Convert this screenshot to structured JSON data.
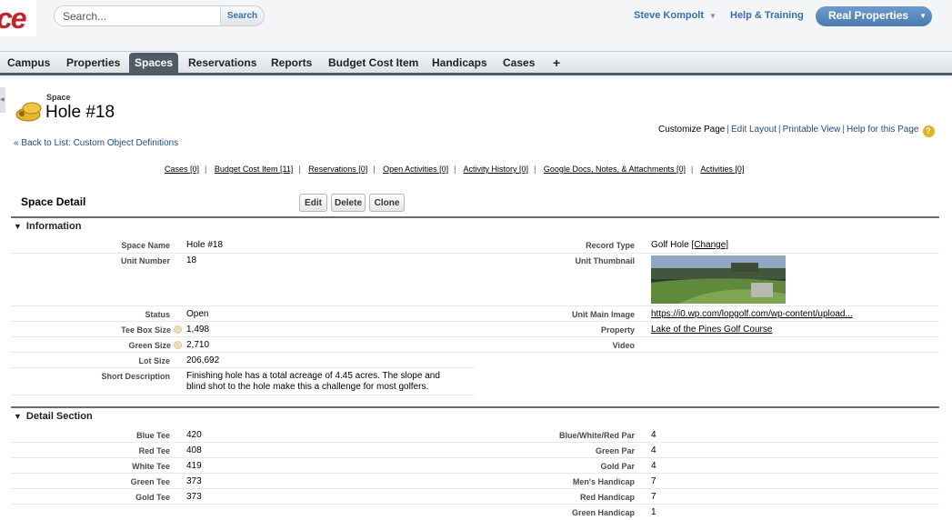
{
  "header": {
    "logo_text": "ce",
    "search_placeholder": "Search...",
    "search_button": "Search",
    "user_name": "Steve Kompolt",
    "help_label": "Help & Training",
    "app_name": "Real Properties"
  },
  "tabs": [
    "Campus",
    "Properties",
    "Spaces",
    "Reservations",
    "Reports",
    "Budget Cost Item",
    "Handicaps",
    "Cases",
    "+"
  ],
  "active_tab": "Spaces",
  "record": {
    "object_type": "Space",
    "title": "Hole #18",
    "back_link": "« Back to List: Custom Object Definitions"
  },
  "page_links": [
    "Customize Page",
    "Edit Layout",
    "Printable View",
    "Help for this Page"
  ],
  "related_links": [
    {
      "label": "Cases",
      "count": "[0]"
    },
    {
      "label": "Budget Cost Item",
      "count": "[11]"
    },
    {
      "label": "Reservations",
      "count": "[0]"
    },
    {
      "label": "Open Activities",
      "count": "[0]"
    },
    {
      "label": "Activity History",
      "count": "[0]"
    },
    {
      "label": "Google Docs, Notes, & Attachments",
      "count": "[0]"
    },
    {
      "label": "Activities",
      "count": "[0]"
    }
  ],
  "detail": {
    "title": "Space Detail",
    "edit_button": "Edit",
    "delete_button": "Delete",
    "clone_button": "Clone"
  },
  "information": {
    "heading": "Information",
    "space_name_label": "Space Name",
    "space_name": "Hole #18",
    "unit_number_label": "Unit Number",
    "unit_number": "18",
    "status_label": "Status",
    "status": "Open",
    "tee_box_label": "Tee Box Size",
    "tee_box": "1,498",
    "green_size_label": "Green Size",
    "green_size": "2,710",
    "lot_size_label": "Lot Size",
    "lot_size": "206,692",
    "short_desc_label": "Short Description",
    "short_desc_line1": "Finishing hole has a total acreage of 4.45 acres. The slope and",
    "short_desc_line2": "blind shot to the hole make this a challenge for most golfers.",
    "record_type_label": "Record Type",
    "record_type": "Golf Hole",
    "change_link": "[Change]",
    "thumbnail_label": "Unit Thumbnail",
    "main_image_label": "Unit Main Image",
    "main_image": "https://i0.wp.com/lopgolf.com/wp-content/upload...",
    "property_label": "Property",
    "property": "Lake of the Pines Golf Course",
    "video_label": "Video"
  },
  "detail_section": {
    "heading": "Detail Section",
    "left": [
      {
        "label": "Blue Tee",
        "value": "420"
      },
      {
        "label": "Red Tee",
        "value": "408"
      },
      {
        "label": "White Tee",
        "value": "419"
      },
      {
        "label": "Green Tee",
        "value": "373"
      },
      {
        "label": "Gold Tee",
        "value": "373"
      }
    ],
    "right": [
      {
        "label": "Blue/White/Red Par",
        "value": "4"
      },
      {
        "label": "Green Par",
        "value": "4"
      },
      {
        "label": "Gold Par",
        "value": "4"
      },
      {
        "label": "Men's Handicap",
        "value": "7"
      },
      {
        "label": "Red Handicap",
        "value": "7"
      },
      {
        "label": "Green Handicap",
        "value": "1"
      }
    ]
  },
  "colors": {
    "active_tab": "#4f5b66",
    "link_blue": "#1f4a7a",
    "app_menu": "#5a89bf",
    "logo_red": "#c0242b"
  }
}
